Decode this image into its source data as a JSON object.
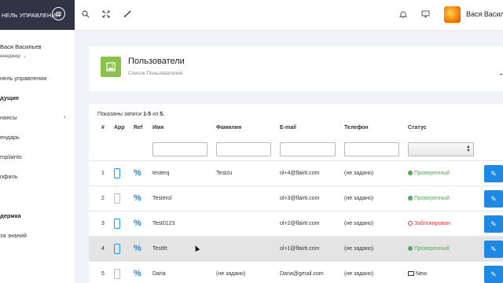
{
  "sidebar": {
    "title": "НЕЛЬ УПРАВЛЕНИЯ",
    "user_name": "Вася Васильев",
    "user_role": "енеджер",
    "items": [
      {
        "label": "нель управления",
        "bold": false
      },
      {
        "label": "дущие",
        "bold": true
      },
      {
        "label": "нансы",
        "bold": false
      },
      {
        "label": "ендарь",
        "bold": false
      },
      {
        "label": "mplaints",
        "bold": false
      },
      {
        "label": "офиль",
        "bold": false
      },
      {
        "label": "держка",
        "bold": true
      },
      {
        "label": "за знаний",
        "bold": false
      }
    ]
  },
  "topbar": {
    "user_name": "Вася Васильев"
  },
  "page_header": {
    "title": "Пользователи",
    "subtitle": "Список Пользователей"
  },
  "table": {
    "shown_prefix": "Показаны записи ",
    "shown_range": "1-5",
    "shown_middle": " из ",
    "shown_total": "5.",
    "columns": [
      "#",
      "App",
      "Ref",
      "Имя",
      "Фамилия",
      "E-mail",
      "Телефон",
      "Статус"
    ],
    "rows": [
      {
        "num": "1",
        "app_active": true,
        "first": "testerq",
        "last": "Testzu",
        "email": "ol+4@flairti.com",
        "phone": "(не задано)",
        "status": "Проверенный",
        "status_kind": "ok"
      },
      {
        "num": "2",
        "app_active": false,
        "first": "Testerol",
        "last": "",
        "email": "ol+3@flairti.com",
        "phone": "(не задано)",
        "status": "Проверенный",
        "status_kind": "ok"
      },
      {
        "num": "3",
        "app_active": true,
        "first": "Test0123",
        "last": "",
        "email": "ol+2@flairti.com",
        "phone": "(не задано)",
        "status": "Заблокирован",
        "status_kind": "blocked"
      },
      {
        "num": "4",
        "app_active": true,
        "first": "Testttt",
        "last": "",
        "email": "ol+1@flairti.com",
        "phone": "(не задано)",
        "status": "Проверенный",
        "status_kind": "ok"
      },
      {
        "num": "5",
        "app_active": false,
        "first": "Daria",
        "last": "(не задано)",
        "email": "Daria@gmail.com",
        "phone": "(не задано)",
        "status": "New",
        "status_kind": "new"
      }
    ]
  },
  "colors": {
    "sidebar_header": "#2f3545",
    "accent_blue": "#1e88e5",
    "status_ok": "#4caf50",
    "status_blocked": "#e53935",
    "header_icon": "#8bc34a"
  }
}
